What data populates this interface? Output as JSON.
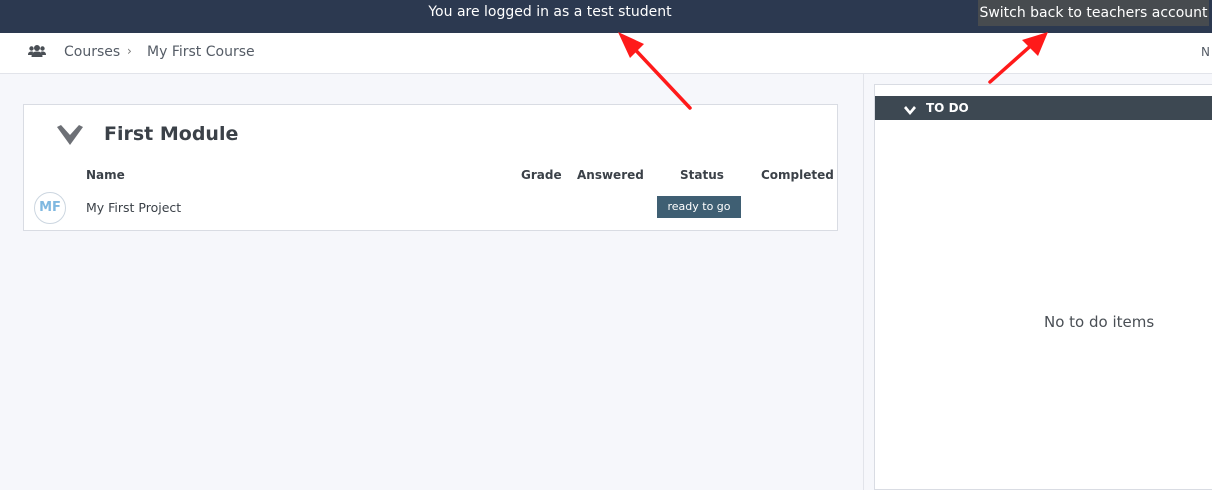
{
  "banner": {
    "message": "You are logged in as a test student",
    "switch_button": "Switch back to teachers account"
  },
  "breadcrumb": {
    "icon": "people-icon",
    "items": [
      "Courses",
      "My First Course"
    ],
    "separator": "›",
    "right_cut_text": "N"
  },
  "module": {
    "title": "First Module",
    "columns": [
      "Name",
      "Grade",
      "Answered",
      "Status",
      "Completed"
    ],
    "rows": [
      {
        "avatar": "MF",
        "name": "My First Project",
        "grade": "",
        "answered": "",
        "status": "ready to go",
        "completed": ""
      }
    ]
  },
  "todo": {
    "title": "TO DO",
    "empty_message": "No to do items"
  },
  "colors": {
    "banner": "#2c3950",
    "switch_button": "#474b4f",
    "status_badge": "#3f5f73",
    "todo_header": "#3d4852",
    "annotation_arrow": "#ff1a1a"
  }
}
